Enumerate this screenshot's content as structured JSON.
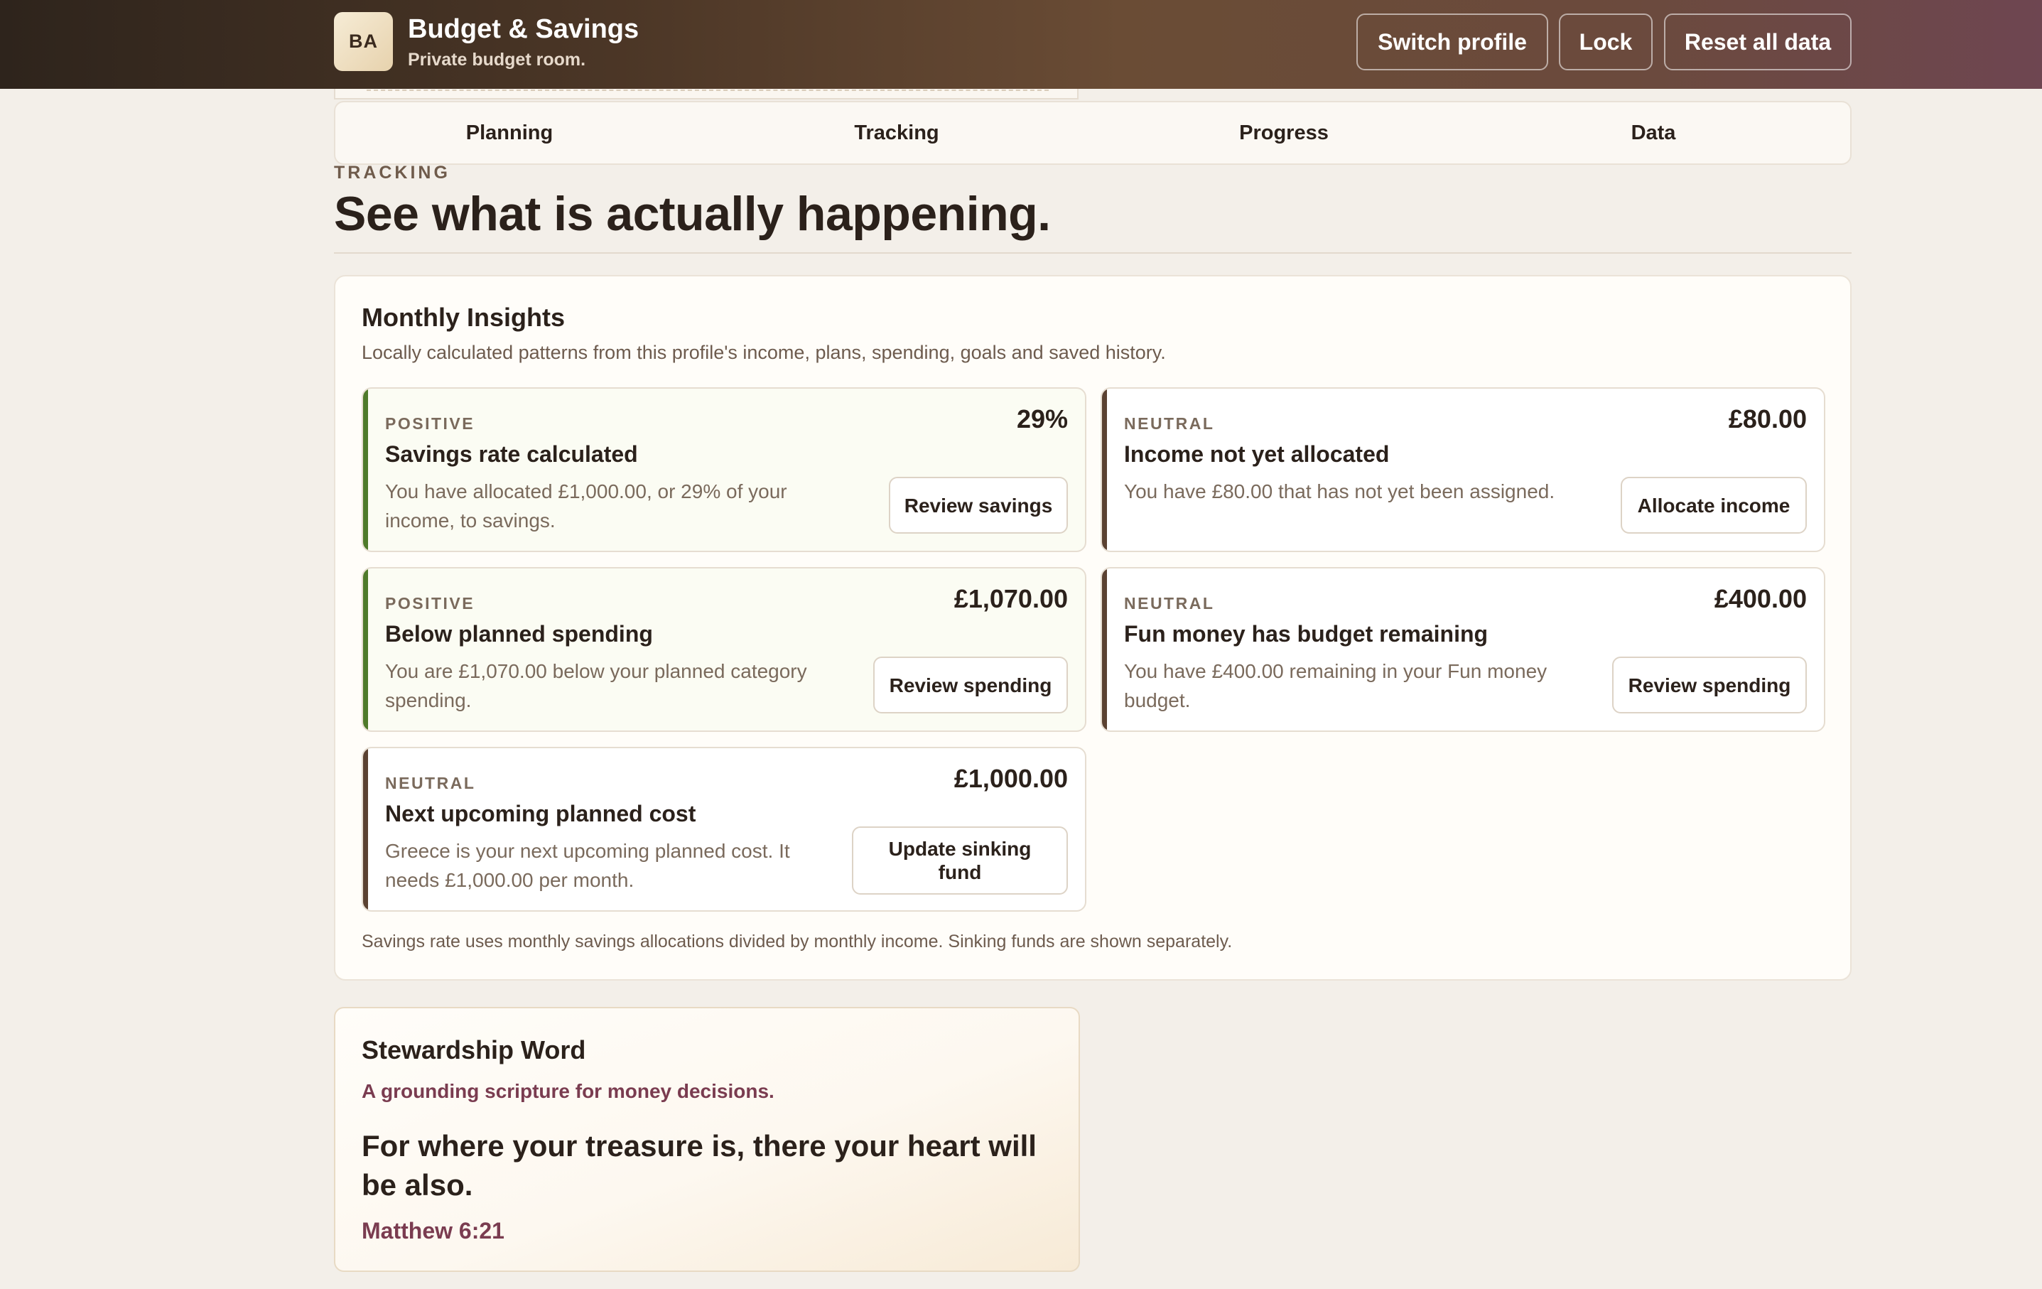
{
  "header": {
    "badge": "BA",
    "title": "Budget & Savings",
    "subtitle": "Private budget room.",
    "buttons": {
      "switch_profile": "Switch profile",
      "lock": "Lock",
      "reset": "Reset all data"
    }
  },
  "tabs": [
    {
      "label": "Planning"
    },
    {
      "label": "Tracking"
    },
    {
      "label": "Progress"
    },
    {
      "label": "Data"
    }
  ],
  "section": {
    "eyebrow": "TRACKING",
    "title": "See what is actually happening."
  },
  "insights": {
    "title": "Monthly Insights",
    "subtitle": "Locally calculated patterns from this profile's income, plans, spending, goals and saved history.",
    "cards": [
      {
        "tone": "POSITIVE",
        "amount": "29%",
        "title": "Savings rate calculated",
        "description": "You have allocated £1,000.00, or 29% of your income, to savings.",
        "action": "Review savings"
      },
      {
        "tone": "NEUTRAL",
        "amount": "£80.00",
        "title": "Income not yet allocated",
        "description": "You have £80.00 that has not yet been assigned.",
        "action": "Allocate income"
      },
      {
        "tone": "POSITIVE",
        "amount": "£1,070.00",
        "title": "Below planned spending",
        "description": "You are £1,070.00 below your planned category spending.",
        "action": "Review spending"
      },
      {
        "tone": "NEUTRAL",
        "amount": "£400.00",
        "title": "Fun money has budget remaining",
        "description": "You have £400.00 remaining in your Fun money budget.",
        "action": "Review spending"
      },
      {
        "tone": "NEUTRAL",
        "amount": "£1,000.00",
        "title": "Next upcoming planned cost",
        "description": "Greece is your next upcoming planned cost. It needs £1,000.00 per month.",
        "action": "Update sinking fund"
      }
    ],
    "footnote": "Savings rate uses monthly savings allocations divided by monthly income. Sinking funds are shown separately."
  },
  "stewardship": {
    "title": "Stewardship Word",
    "subtitle": "A grounding scripture for money decisions.",
    "verse": "For where your treasure is, there your heart will be also.",
    "reference": "Matthew 6:21"
  },
  "colors": {
    "positive_accent": "#4f7a2b",
    "neutral_accent": "#5b4232",
    "scripture_accent": "#7a3c50"
  }
}
